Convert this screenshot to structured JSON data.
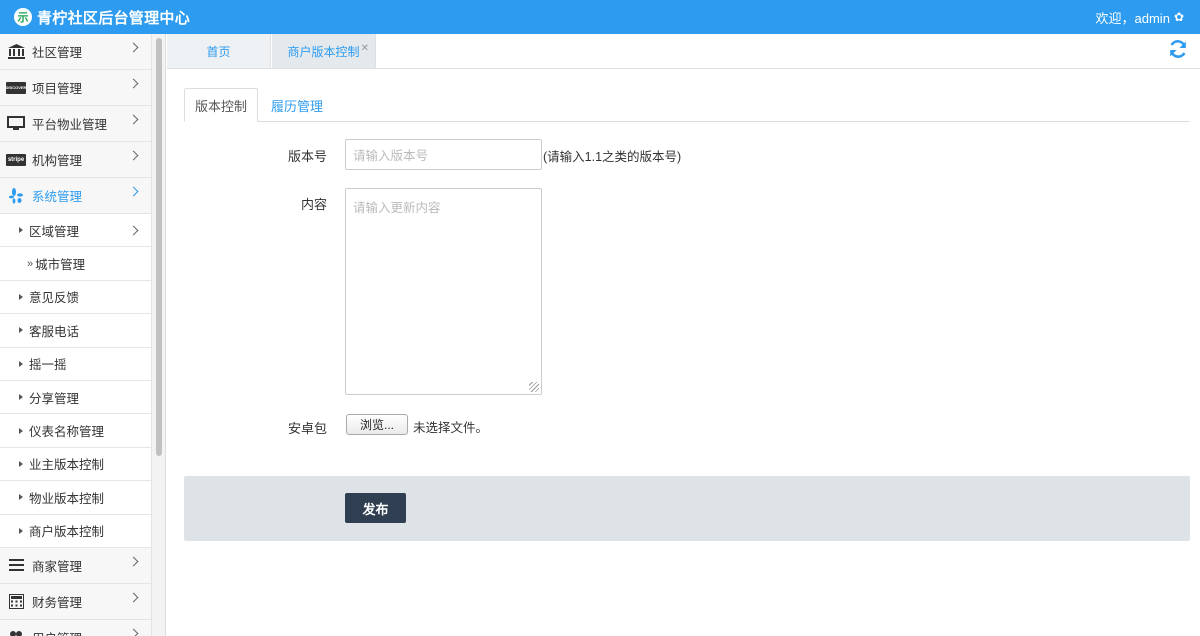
{
  "app": {
    "title": "青柠社区后台管理中心",
    "logo_glyph": "示",
    "welcome": "欢迎，admin",
    "brand_color": "#2d9cf0"
  },
  "sidebar": {
    "items": [
      {
        "label": "社区管理",
        "icon": "bank-icon"
      },
      {
        "label": "项目管理",
        "icon": "card-icon"
      },
      {
        "label": "平台物业管理",
        "icon": "monitor-icon"
      },
      {
        "label": "机构管理",
        "icon": "stripe-icon"
      },
      {
        "label": "系统管理",
        "icon": "yelp-icon",
        "active": true
      }
    ],
    "sub_items": [
      {
        "label": "区域管理"
      },
      {
        "label": "城市管理"
      },
      {
        "label": "意见反馈"
      },
      {
        "label": "客服电话"
      },
      {
        "label": "摇一摇"
      },
      {
        "label": "分享管理"
      },
      {
        "label": "仪表名称管理"
      },
      {
        "label": "业主版本控制"
      },
      {
        "label": "物业版本控制"
      },
      {
        "label": "商户版本控制"
      }
    ],
    "bottom_items": [
      {
        "label": "商家管理",
        "icon": "list-icon"
      },
      {
        "label": "财务管理",
        "icon": "calculator-icon"
      },
      {
        "label": "用户管理",
        "icon": "users-icon"
      }
    ],
    "card_icon_text": "DISCOVER",
    "stripe_icon_text": "stripe"
  },
  "tabs": [
    {
      "label": "首页"
    },
    {
      "label": "商户版本控制",
      "active": true
    }
  ],
  "subtabs": [
    {
      "label": "版本控制",
      "active": true
    },
    {
      "label": "履历管理"
    }
  ],
  "form": {
    "version_label": "版本号",
    "version_placeholder": "请输入版本号",
    "version_hint": "(请输入1.1之类的版本号)",
    "content_label": "内容",
    "content_placeholder": "请输入更新内容",
    "apk_label": "安卓包",
    "browse_label": "浏览...",
    "no_file_text": "未选择文件。",
    "publish_label": "发布"
  }
}
